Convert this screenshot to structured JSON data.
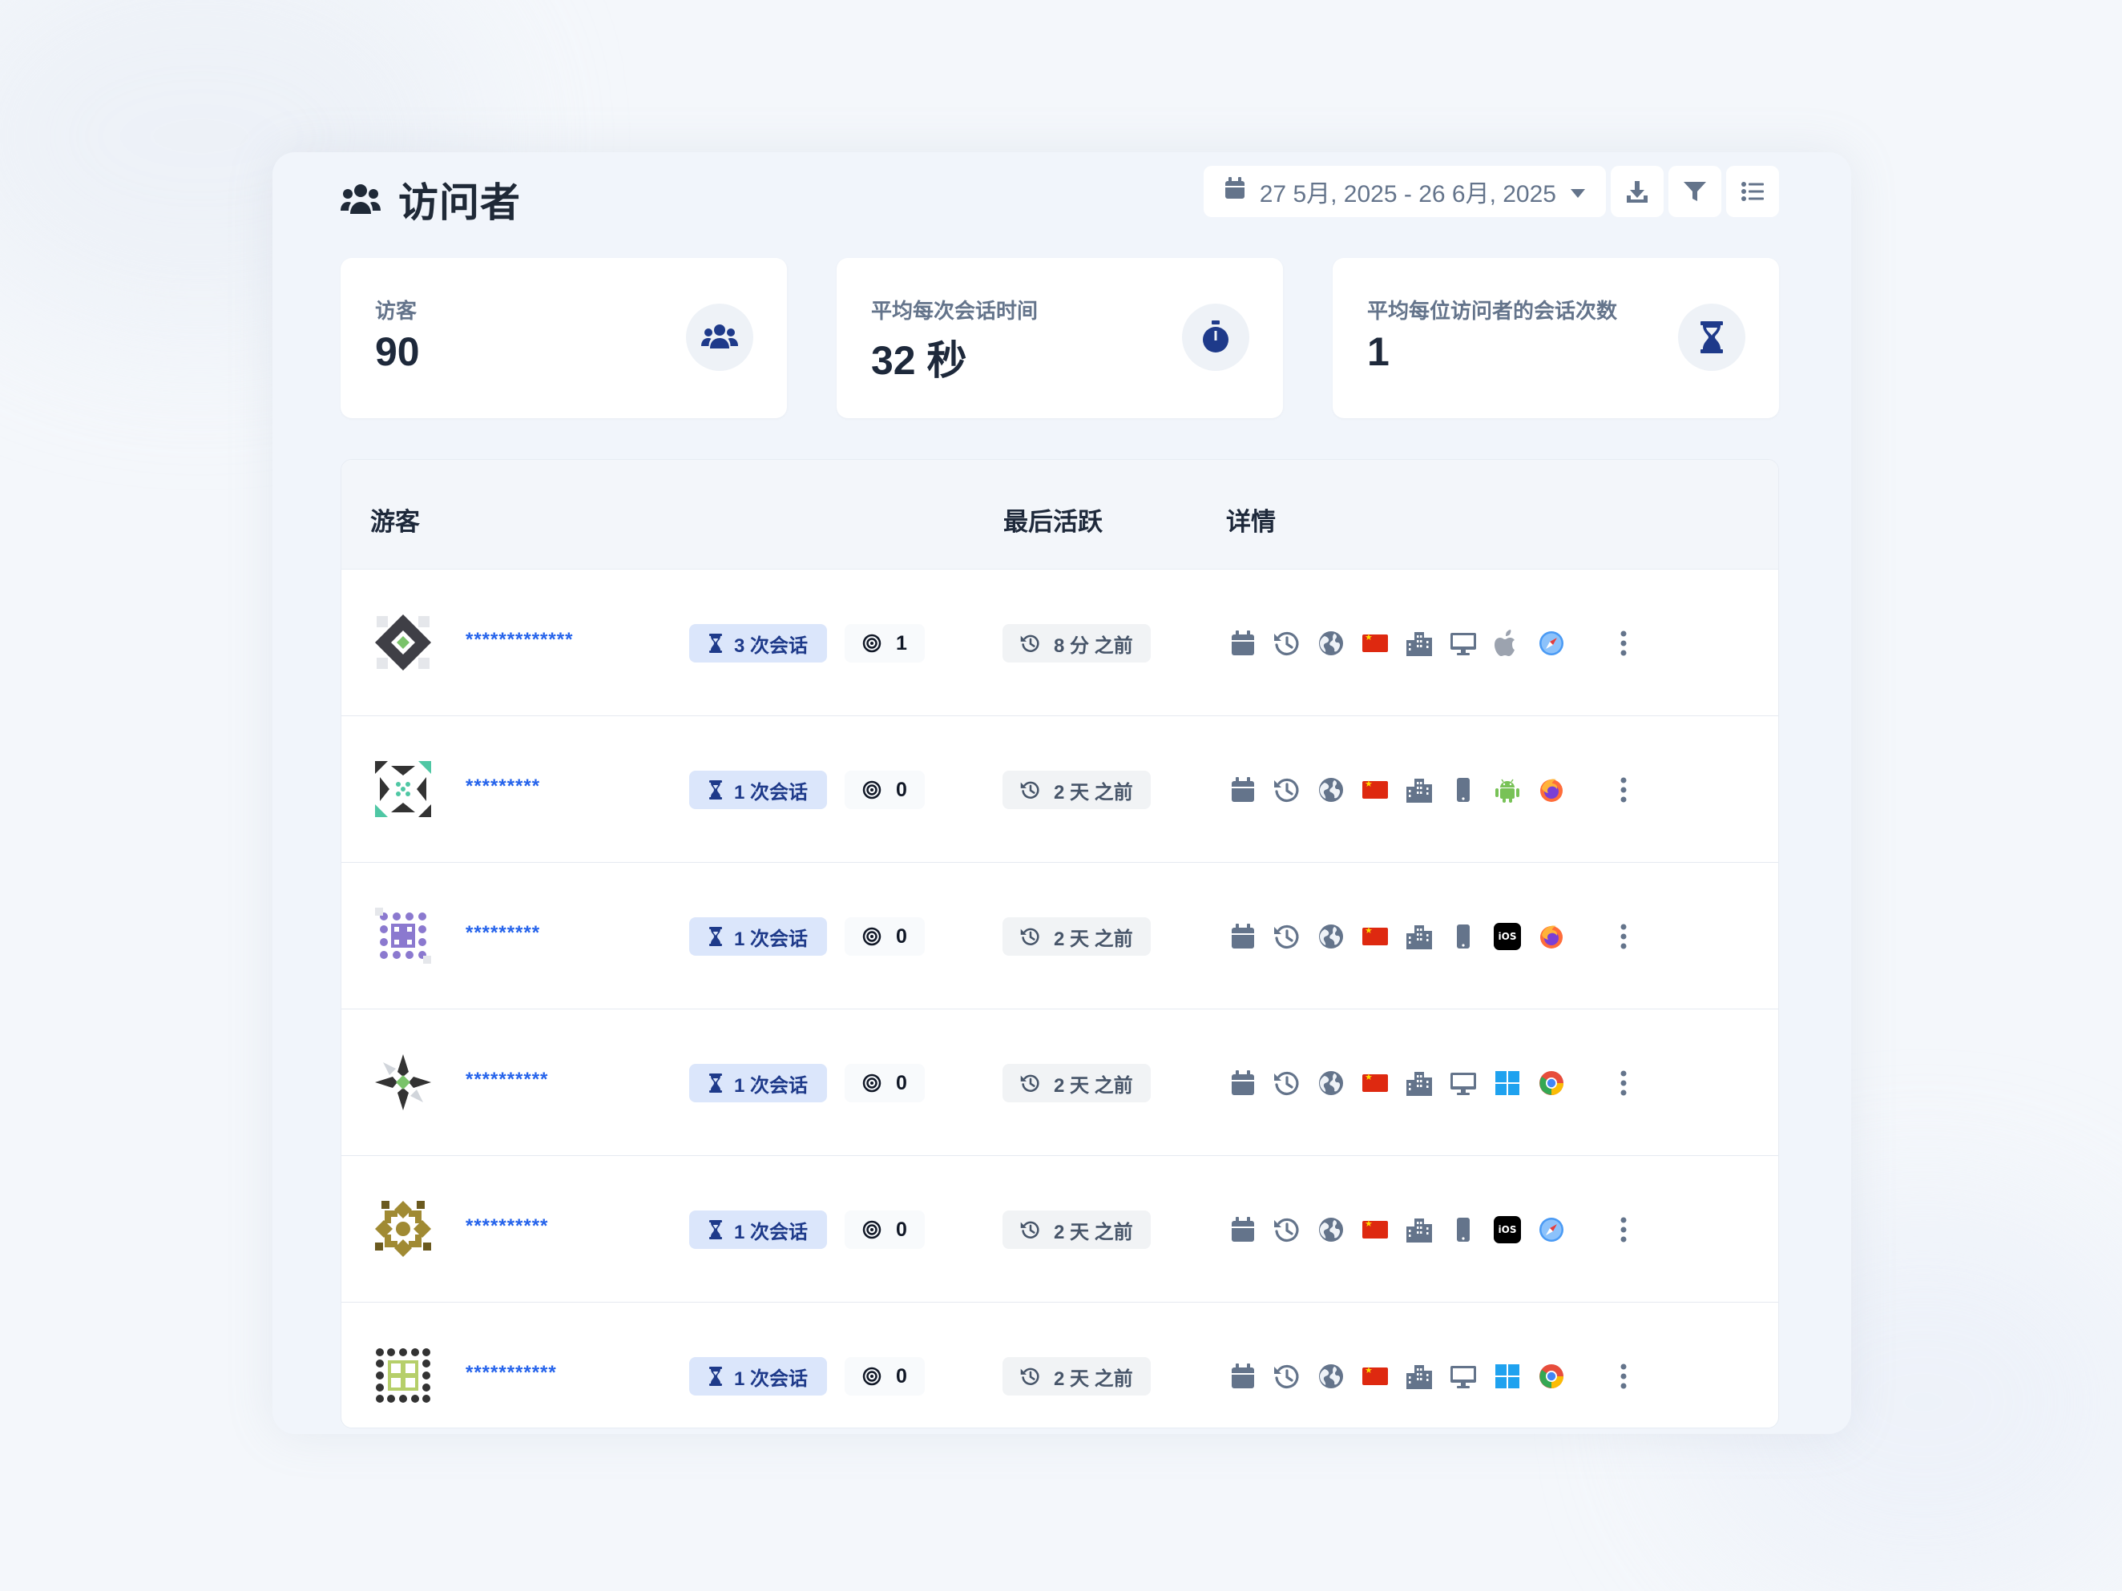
{
  "page": {
    "title": "访问者",
    "title_icon": "users-icon"
  },
  "toolbar": {
    "date_range": "27 5月, 2025 - 26 6月, 2025",
    "icons": [
      "calendar-icon",
      "caret-down-icon",
      "download-icon",
      "filter-icon",
      "list-icon"
    ]
  },
  "stats": [
    {
      "label": "访客",
      "value": "90",
      "icon": "users-icon"
    },
    {
      "label": "平均每次会话时间",
      "value": "32 秒",
      "icon": "stopwatch-icon"
    },
    {
      "label": "平均每位访问者的会话次数",
      "value": "1",
      "icon": "hourglass-icon"
    }
  ],
  "table": {
    "columns": {
      "visitor": "游客",
      "last_active": "最后活跃",
      "details": "详情"
    },
    "rows": [
      {
        "name": "*************",
        "sessions": "3 次会话",
        "goals": "1",
        "last_active": "8 分 之前",
        "device": "desktop",
        "os": "apple",
        "browser": "safari"
      },
      {
        "name": "*********",
        "sessions": "1 次会话",
        "goals": "0",
        "last_active": "2 天 之前",
        "device": "mobile",
        "os": "android",
        "browser": "firefox"
      },
      {
        "name": "*********",
        "sessions": "1 次会话",
        "goals": "0",
        "last_active": "2 天 之前",
        "device": "mobile",
        "os": "ios",
        "os_label": "iOS",
        "browser": "firefox"
      },
      {
        "name": "**********",
        "sessions": "1 次会话",
        "goals": "0",
        "last_active": "2 天 之前",
        "device": "desktop",
        "os": "windows",
        "browser": "chrome"
      },
      {
        "name": "**********",
        "sessions": "1 次会话",
        "goals": "0",
        "last_active": "2 天 之前",
        "device": "mobile",
        "os": "ios",
        "os_label": "iOS",
        "browser": "safari"
      },
      {
        "name": "***********",
        "sessions": "1 次会话",
        "goals": "0",
        "last_active": "2 天 之前",
        "device": "desktop",
        "os": "windows",
        "browser": "chrome"
      }
    ]
  },
  "colors": {
    "accent": "#2563eb",
    "badge_bg": "#dbe6fb",
    "badge_text": "#1e3a8a",
    "muted": "#64748b",
    "icon_gray": "#64748b"
  }
}
